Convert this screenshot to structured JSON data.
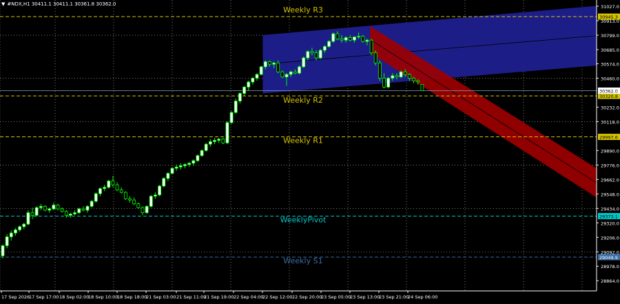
{
  "header": {
    "symbol_line": "#NDX,H1  30411.1 30411.1 30361.8 30362.0",
    "menu_icon": "dropdown-triangle"
  },
  "colors": {
    "background": "#000000",
    "grid": "#ffffff",
    "bull_candle": "#00ff00",
    "bear_candle": "#000000",
    "candle_outline": "#00ff00",
    "doji_fill": "#ffffff",
    "up_channel": "#1f1f8f",
    "down_channel": "#a00000",
    "pivot_yellow": "#d4c400",
    "pivot_cyan": "#00c8c8",
    "pivot_blue": "#3a6ea5",
    "price_marker": "#ffffff"
  },
  "levels": [
    {
      "name": "Weekly R3",
      "price": 30945.3,
      "label": "Weekly R3",
      "tag": "30945.3",
      "color": "#d4c400",
      "tag_bg": "#d4c400",
      "tag_fg": "#000000"
    },
    {
      "name": "Weekly R2",
      "price": 30320.8,
      "label": "Weekly R2",
      "tag": "30320.8",
      "color": "#d4c400",
      "tag_bg": "#d4c400",
      "tag_fg": "#000000"
    },
    {
      "name": "Weekly R1",
      "price": 29997.6,
      "label": "Weekly R1",
      "tag": "29997.6",
      "color": "#d4c400",
      "tag_bg": "#d4c400",
      "tag_fg": "#000000"
    },
    {
      "name": "WeeklyPivot",
      "price": 29373.1,
      "label": "WeeklyPivot",
      "tag": "29373.1",
      "color": "#00c8c8",
      "tag_bg": "#00c8c8",
      "tag_fg": "#000000"
    },
    {
      "name": "Weekly S1",
      "price": 29049.9,
      "label": "Weekly S1",
      "tag": "29049.9",
      "color": "#3a6ea5",
      "tag_bg": "#3a6ea5",
      "tag_fg": "#ffffff"
    }
  ],
  "current_price": {
    "value": 30362.0,
    "tag": "30362.0"
  },
  "price_axis": {
    "min": 28800,
    "max": 31060,
    "labels": [
      "31027.0",
      "30913.0",
      "30799.0",
      "30685.0",
      "30574.0",
      "30460.0",
      "30232.0",
      "30118.0",
      "29890.0",
      "29776.0",
      "29662.0",
      "29548.0",
      "29434.0",
      "29320.0",
      "29206.0",
      "29092.0",
      "28978.0",
      "28864.0"
    ]
  },
  "time_axis": {
    "labels": [
      "17 Sep 2026",
      "17 Sep 17:00",
      "18 Sep 02:00",
      "18 Sep 10:00",
      "18 Sep 18:00",
      "21 Sep 03:00",
      "21 Sep 11:00",
      "21 Sep 19:00",
      "22 Sep 04:00",
      "22 Sep 12:00",
      "22 Sep 20:00",
      "23 Sep 05:00",
      "23 Sep 13:00",
      "23 Sep 21:00",
      "24 Sep 06:00"
    ]
  },
  "chart_data": {
    "type": "candlestick",
    "symbol": "#NDX",
    "timeframe": "H1",
    "ohlc_last": {
      "open": 30411.1,
      "high": 30411.1,
      "low": 30361.8,
      "close": 30362.0
    },
    "ylim": [
      28800,
      31060
    ],
    "candles": [
      [
        29060,
        29150,
        29040,
        29140
      ],
      [
        29140,
        29230,
        29120,
        29210
      ],
      [
        29210,
        29260,
        29180,
        29240
      ],
      [
        29240,
        29280,
        29220,
        29265
      ],
      [
        29265,
        29300,
        29250,
        29290
      ],
      [
        29290,
        29320,
        29270,
        29310
      ],
      [
        29310,
        29420,
        29300,
        29400
      ],
      [
        29400,
        29440,
        29350,
        29380
      ],
      [
        29380,
        29450,
        29370,
        29440
      ],
      [
        29440,
        29470,
        29420,
        29450
      ],
      [
        29450,
        29460,
        29410,
        29420
      ],
      [
        29420,
        29440,
        29400,
        29430
      ],
      [
        29430,
        29480,
        29420,
        29460
      ],
      [
        29460,
        29470,
        29420,
        29430
      ],
      [
        29430,
        29440,
        29400,
        29410
      ],
      [
        29410,
        29420,
        29360,
        29380
      ],
      [
        29380,
        29400,
        29360,
        29390
      ],
      [
        29390,
        29420,
        29380,
        29400
      ],
      [
        29400,
        29440,
        29390,
        29430
      ],
      [
        29430,
        29450,
        29410,
        29420
      ],
      [
        29420,
        29460,
        29400,
        29450
      ],
      [
        29450,
        29500,
        29440,
        29490
      ],
      [
        29490,
        29560,
        29480,
        29550
      ],
      [
        29550,
        29600,
        29530,
        29590
      ],
      [
        29590,
        29620,
        29570,
        29600
      ],
      [
        29600,
        29660,
        29590,
        29650
      ],
      [
        29650,
        29690,
        29600,
        29620
      ],
      [
        29620,
        29640,
        29570,
        29580
      ],
      [
        29580,
        29600,
        29550,
        29560
      ],
      [
        29560,
        29570,
        29500,
        29510
      ],
      [
        29510,
        29530,
        29480,
        29500
      ],
      [
        29500,
        29520,
        29460,
        29470
      ],
      [
        29470,
        29480,
        29430,
        29440
      ],
      [
        29440,
        29450,
        29380,
        29400
      ],
      [
        29400,
        29460,
        29390,
        29450
      ],
      [
        29450,
        29540,
        29440,
        29530
      ],
      [
        29530,
        29560,
        29510,
        29540
      ],
      [
        29540,
        29620,
        29530,
        29610
      ],
      [
        29610,
        29680,
        29600,
        29670
      ],
      [
        29670,
        29720,
        29650,
        29710
      ],
      [
        29710,
        29760,
        29700,
        29750
      ],
      [
        29750,
        29780,
        29730,
        29760
      ],
      [
        29760,
        29790,
        29740,
        29770
      ],
      [
        29770,
        29790,
        29750,
        29780
      ],
      [
        29780,
        29800,
        29760,
        29790
      ],
      [
        29790,
        29820,
        29770,
        29810
      ],
      [
        29810,
        29860,
        29800,
        29850
      ],
      [
        29850,
        29900,
        29840,
        29890
      ],
      [
        29890,
        29950,
        29880,
        29940
      ],
      [
        29940,
        29980,
        29920,
        29960
      ],
      [
        29960,
        29990,
        29940,
        29970
      ],
      [
        29970,
        29990,
        29950,
        29980
      ],
      [
        29980,
        29990,
        29940,
        29950
      ],
      [
        29950,
        30120,
        29940,
        30110
      ],
      [
        30110,
        30200,
        30100,
        30190
      ],
      [
        30190,
        30300,
        30180,
        30280
      ],
      [
        30280,
        30350,
        30260,
        30340
      ],
      [
        30340,
        30400,
        30320,
        30390
      ],
      [
        30390,
        30440,
        30360,
        30430
      ],
      [
        30430,
        30470,
        30410,
        30460
      ],
      [
        30460,
        30500,
        30440,
        30490
      ],
      [
        30490,
        30560,
        30480,
        30550
      ],
      [
        30550,
        30600,
        30530,
        30590
      ],
      [
        30590,
        30600,
        30550,
        30570
      ],
      [
        30570,
        30590,
        30540,
        30580
      ],
      [
        30580,
        30600,
        30500,
        30510
      ],
      [
        30510,
        30520,
        30460,
        30470
      ],
      [
        30470,
        30500,
        30400,
        30490
      ],
      [
        30490,
        30520,
        30470,
        30510
      ],
      [
        30510,
        30530,
        30490,
        30500
      ],
      [
        30500,
        30560,
        30490,
        30550
      ],
      [
        30550,
        30630,
        30540,
        30620
      ],
      [
        30620,
        30680,
        30600,
        30670
      ],
      [
        30670,
        30700,
        30640,
        30660
      ],
      [
        30660,
        30680,
        30600,
        30620
      ],
      [
        30620,
        30690,
        30610,
        30680
      ],
      [
        30680,
        30720,
        30660,
        30710
      ],
      [
        30710,
        30760,
        30700,
        30750
      ],
      [
        30750,
        30820,
        30740,
        30810
      ],
      [
        30810,
        30830,
        30760,
        30770
      ],
      [
        30770,
        30800,
        30740,
        30760
      ],
      [
        30760,
        30790,
        30740,
        30780
      ],
      [
        30780,
        30800,
        30750,
        30760
      ],
      [
        30760,
        30790,
        30740,
        30785
      ],
      [
        30785,
        30820,
        30770,
        30790
      ],
      [
        30790,
        30800,
        30740,
        30750
      ],
      [
        30750,
        30770,
        30720,
        30760
      ],
      [
        30760,
        30770,
        30640,
        30660
      ],
      [
        30660,
        30680,
        30560,
        30580
      ],
      [
        30580,
        30600,
        30440,
        30460
      ],
      [
        30460,
        30500,
        30380,
        30390
      ],
      [
        30390,
        30470,
        30380,
        30460
      ],
      [
        30460,
        30500,
        30440,
        30480
      ],
      [
        30480,
        30500,
        30450,
        30470
      ],
      [
        30470,
        30520,
        30460,
        30510
      ],
      [
        30510,
        30530,
        30470,
        30490
      ],
      [
        30490,
        30500,
        30440,
        30460
      ],
      [
        30460,
        30470,
        30420,
        30440
      ],
      [
        30440,
        30450,
        30410,
        30430
      ],
      [
        30411.1,
        30411.1,
        30361.8,
        30362.0
      ]
    ],
    "up_channel": {
      "start_index": 63,
      "upper_start": 30800,
      "upper_end": 31030,
      "lower_start": 30340,
      "lower_end": 30560
    },
    "down_channel": {
      "start_index": 88,
      "upper_start": 30870,
      "upper_end": 29750,
      "lower_start": 30660,
      "lower_end": 29520
    }
  }
}
